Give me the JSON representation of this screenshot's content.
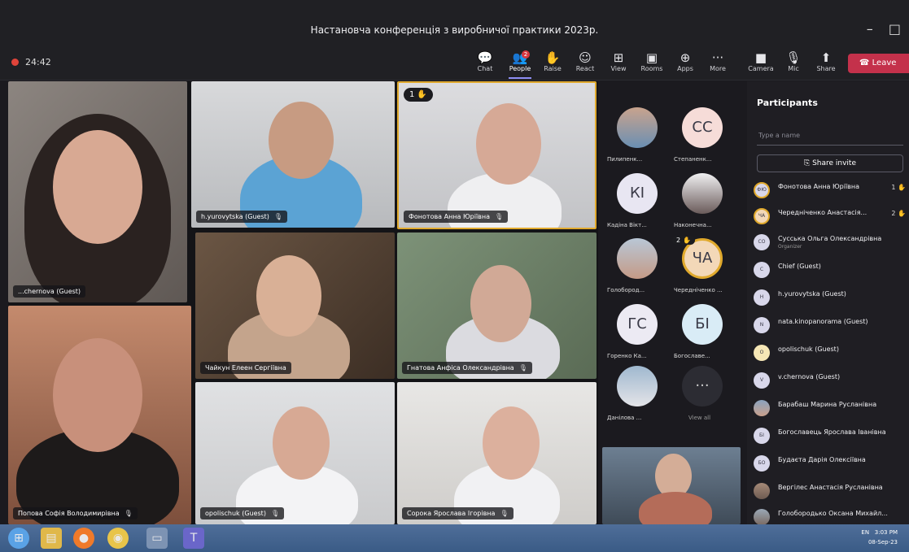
{
  "window": {
    "title": "Настановча конференція з виробничої практики 2023р.",
    "minimize": "–",
    "maximize": "□"
  },
  "toolbar": {
    "timer": "24:42",
    "buttons": [
      {
        "label": "Chat",
        "icon": "chat-icon"
      },
      {
        "label": "People",
        "icon": "people-icon",
        "badge": "2"
      },
      {
        "label": "Raise",
        "icon": "raise-hand-icon"
      },
      {
        "label": "React",
        "icon": "react-icon"
      },
      {
        "label": "View",
        "icon": "view-icon"
      },
      {
        "label": "Rooms",
        "icon": "rooms-icon"
      },
      {
        "label": "Apps",
        "icon": "apps-icon"
      },
      {
        "label": "More",
        "icon": "more-icon"
      },
      {
        "label": "Camera",
        "icon": "camera-icon"
      },
      {
        "label": "Mic",
        "icon": "mic-icon"
      },
      {
        "label": "Share",
        "icon": "share-icon"
      }
    ],
    "leave_label": "Leave"
  },
  "stage": {
    "tiles": [
      {
        "name": "...chernova (Guest)"
      },
      {
        "name": "h.yurovytska (Guest)"
      },
      {
        "name": "Фонотова Анна Юріївна",
        "hand": "1"
      },
      {
        "name": "Чайкун Елеен Сергіївна"
      },
      {
        "name": "Гнатова Анфіса Олександрівна"
      },
      {
        "name": "Попова Софія Володимирівна"
      },
      {
        "name": "opolischuk (Guest)"
      },
      {
        "name": "Сорока Ярослава Ігорівна"
      }
    ]
  },
  "strip": {
    "avatars": [
      {
        "initials": "",
        "name": "Пилипенк..."
      },
      {
        "initials": "СС",
        "name": "Степаненк..."
      },
      {
        "initials": "КІ",
        "name": "Кадіна Вікт..."
      },
      {
        "initials": "",
        "name": "Наконечна..."
      },
      {
        "initials": "",
        "name": "Голобород..."
      },
      {
        "initials": "ЧА",
        "name": "Чередніченко ...",
        "hand": "2"
      },
      {
        "initials": "ГС",
        "name": "Горенко Ка..."
      },
      {
        "initials": "БІ",
        "name": "Богославе..."
      },
      {
        "initials": "",
        "name": "Данілова ..."
      },
      {
        "initials": "···",
        "name": "View all"
      }
    ]
  },
  "panel": {
    "title": "Participants",
    "search_placeholder": "Type a name",
    "share_invite": "Share invite",
    "participants": [
      {
        "initials": "ФЮ",
        "name": "Фонотова Анна Юріївна",
        "meta": "1 ✋"
      },
      {
        "initials": "ЧА",
        "name": "Чередніченко Анастасія...",
        "meta": "2 ✋"
      },
      {
        "initials": "СО",
        "name": "Сусська Ольга Олександрівна",
        "role": "Organizer"
      },
      {
        "initials": "C",
        "name": "Chief (Guest)"
      },
      {
        "initials": "H",
        "name": "h.yurovytska (Guest)"
      },
      {
        "initials": "N",
        "name": "nata.kinopanorama (Guest)"
      },
      {
        "initials": "O",
        "name": "opolischuk (Guest)"
      },
      {
        "initials": "V",
        "name": "v.chernova (Guest)"
      },
      {
        "initials": "",
        "name": "Барабаш Марина Русланівна"
      },
      {
        "initials": "БІ",
        "name": "Богославець Ярослава Іванівна"
      },
      {
        "initials": "БО",
        "name": "Будаєта Дарія Олексіївна"
      },
      {
        "initials": "",
        "name": "Вергілес Анастасія Русланівна"
      },
      {
        "initials": "",
        "name": "Голобородько Оксана Михайл..."
      }
    ]
  },
  "taskbar": {
    "lang": "EN",
    "time": "3:03 PM",
    "date": "08-Sep-23"
  }
}
